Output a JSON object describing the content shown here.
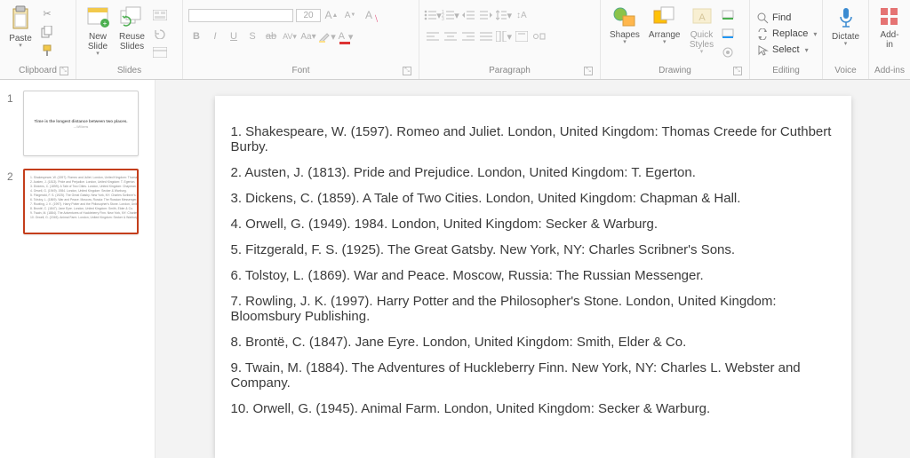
{
  "ribbon": {
    "clipboard": {
      "title": "Clipboard",
      "paste": "Paste"
    },
    "slides": {
      "title": "Slides",
      "new_slide": "New\nSlide",
      "reuse": "Reuse\nSlides"
    },
    "font": {
      "title": "Font",
      "name": "",
      "size": "20"
    },
    "paragraph": {
      "title": "Paragraph"
    },
    "drawing": {
      "title": "Drawing",
      "shapes": "Shapes",
      "arrange": "Arrange",
      "quick": "Quick\nStyles"
    },
    "editing": {
      "title": "Editing",
      "find": "Find",
      "replace": "Replace",
      "select": "Select"
    },
    "voice": {
      "title": "Voice",
      "dictate": "Dictate"
    },
    "addins": {
      "title": "Add-ins",
      "label": "Add-in"
    }
  },
  "panel": {
    "slides": [
      {
        "num": "1",
        "title": "Time is the longest distance between two places.",
        "sub": "—Williams"
      },
      {
        "num": "2"
      }
    ]
  },
  "references": [
    "1. Shakespeare, W. (1597). Romeo and Juliet. London, United Kingdom: Thomas Creede for Cuthbert Burby.",
    "2. Austen, J. (1813). Pride and Prejudice. London, United Kingdom: T. Egerton.",
    "3. Dickens, C. (1859). A Tale of Two Cities. London, United Kingdom: Chapman & Hall.",
    "4. Orwell, G. (1949). 1984. London, United Kingdom: Secker & Warburg.",
    "5. Fitzgerald, F. S. (1925). The Great Gatsby. New York, NY: Charles Scribner's Sons.",
    "6. Tolstoy, L. (1869). War and Peace. Moscow, Russia: The Russian Messenger.",
    "7. Rowling, J. K. (1997). Harry Potter and the Philosopher's Stone. London, United Kingdom: Bloomsbury Publishing.",
    "8. Brontë, C. (1847). Jane Eyre. London, United Kingdom: Smith, Elder & Co.",
    "9. Twain, M. (1884). The Adventures of Huckleberry Finn. New York, NY: Charles L. Webster and Company.",
    "10. Orwell, G. (1945). Animal Farm. London, United Kingdom: Secker & Warburg."
  ]
}
